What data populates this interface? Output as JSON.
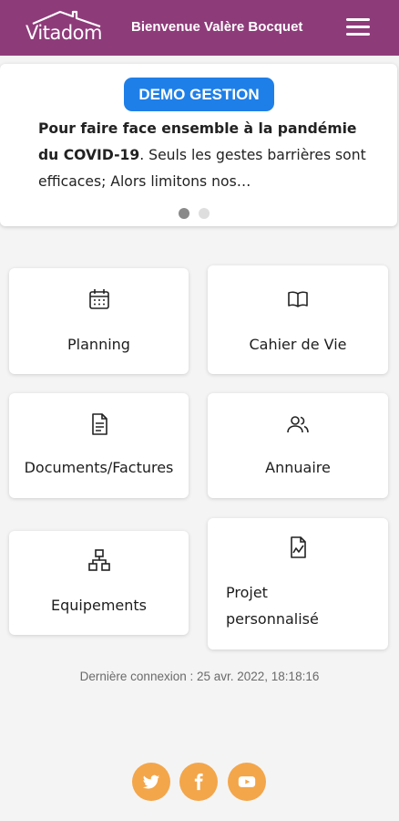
{
  "header": {
    "logo_text": "Vitadom",
    "welcome": "Bienvenue Valère Bocquet",
    "menu_icon": "hamburger-menu-icon",
    "bg_color": "#8e3b7a"
  },
  "news": {
    "badge": "DEMO GESTION",
    "headline": "Pour faire face ensemble à la pandémie du COVID-19",
    "body": ". Seuls les gestes barrières sont efficaces; Alors limitons nos…",
    "slides_total": 2,
    "active_slide": 1
  },
  "tiles": [
    {
      "label": "Planning",
      "icon": "calendar-icon"
    },
    {
      "label": "Cahier de Vie",
      "icon": "book-icon"
    },
    {
      "label": "Documents/Factures",
      "icon": "document-icon"
    },
    {
      "label": "Annuaire",
      "icon": "users-icon"
    },
    {
      "label": "Equipements",
      "icon": "hierarchy-icon"
    },
    {
      "label": "Projet personnalisé",
      "icon": "chart-file-icon"
    }
  ],
  "footer": {
    "last_login": "Dernière connexion : 25 avr. 2022, 18:18:16",
    "social": [
      {
        "name": "twitter-icon"
      },
      {
        "name": "facebook-icon"
      },
      {
        "name": "youtube-icon"
      }
    ],
    "social_color": "#f3a64a"
  }
}
